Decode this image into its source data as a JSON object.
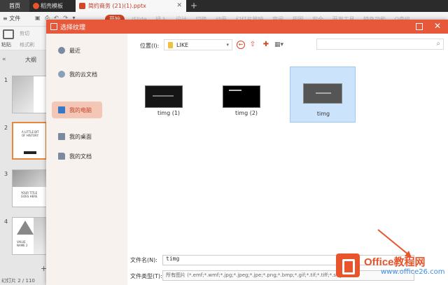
{
  "colors": {
    "accent": "#e7583a",
    "selection": "#cce4fb",
    "sidebar_active": "#f3c6b6"
  },
  "tabs": {
    "home": "首页",
    "template": "稻壳模板",
    "document": "简约商务 (21)(1).pptx"
  },
  "ribbon": {
    "file_menu": "文件",
    "start_tab": "开始",
    "other_tabs": "iSlide 插入 设计 切换 动画 幻灯片放映 审阅 视图 安全 开发工具 特色功能 Q查找",
    "paste_label": "粘贴",
    "cut_label": "剪切",
    "format_painter_label": "格式刷"
  },
  "left_panel": {
    "outline_label": "大纲",
    "slide_numbers": [
      "1",
      "2",
      "3",
      "4"
    ],
    "slide2_text": "A LITTLE BIT OF HISTORY",
    "slide3_text": "YOUR TITLE GOES HERE",
    "slide4_text": "VALUE NAME 2",
    "status": "幻灯片 2 / 110"
  },
  "dialog": {
    "title": "选择纹理",
    "sidebar": [
      {
        "label": "最近",
        "icon": "clock-icon"
      },
      {
        "label": "我的云文档",
        "icon": "cloud-icon"
      },
      {
        "label": "我的电脑",
        "icon": "computer-icon"
      },
      {
        "label": "我的桌面",
        "icon": "desktop-icon"
      },
      {
        "label": "我的文档",
        "icon": "folder-icon"
      }
    ],
    "location_label": "位置(I):",
    "location_value": "LIKE",
    "search_placeholder": "",
    "files": [
      {
        "name": "timg (1)"
      },
      {
        "name": "timg (2)"
      },
      {
        "name": "timg"
      }
    ],
    "filename_label": "文件名(N):",
    "filename_value": "timg",
    "filetype_label": "文件类型(T):",
    "filetype_value": "所有图片 (*.emf;*.wmf;*.jpg;*.jpeg;*.jpe;*.png;*.bmp;*.gif;*.tif;*.tiff;*.svg)"
  },
  "watermark": {
    "brand": "Office教程网",
    "url": "www.office26.com"
  }
}
